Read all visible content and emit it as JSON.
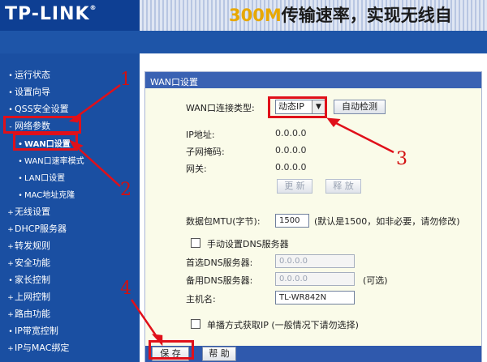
{
  "header": {
    "logo": "TP-LINK",
    "logo_mark": "®",
    "banner_prefix": "300M",
    "banner_text": "传输速率，实现无线自"
  },
  "sidebar": {
    "items": [
      {
        "label": "运行状态",
        "bullet": "•"
      },
      {
        "label": "设置向导",
        "bullet": "•"
      },
      {
        "label": "QSS安全设置",
        "bullet": "•"
      },
      {
        "label": "网络参数",
        "bullet": "-"
      },
      {
        "label": "WAN口设置",
        "bullet": "•"
      },
      {
        "label": "WAN口速率模式",
        "bullet": "•"
      },
      {
        "label": "LAN口设置",
        "bullet": "•"
      },
      {
        "label": "MAC地址克隆",
        "bullet": "•"
      },
      {
        "label": "无线设置",
        "bullet": "+"
      },
      {
        "label": "DHCP服务器",
        "bullet": "+"
      },
      {
        "label": "转发规则",
        "bullet": "+"
      },
      {
        "label": "安全功能",
        "bullet": "+"
      },
      {
        "label": "家长控制",
        "bullet": "•"
      },
      {
        "label": "上网控制",
        "bullet": "+"
      },
      {
        "label": "路由功能",
        "bullet": "+"
      },
      {
        "label": "IP带宽控制",
        "bullet": "•"
      },
      {
        "label": "IP与MAC绑定",
        "bullet": "+"
      }
    ]
  },
  "panel": {
    "title": "WAN口设置",
    "conn_type_label": "WAN口连接类型:",
    "conn_type_value": "动态IP",
    "auto_detect": "自动检测",
    "ip_label": "IP地址:",
    "ip_value": "0.0.0.0",
    "mask_label": "子网掩码:",
    "mask_value": "0.0.0.0",
    "gateway_label": "网关:",
    "gateway_value": "0.0.0.0",
    "renew": "更 新",
    "release": "释 放",
    "mtu_label": "数据包MTU(字节):",
    "mtu_value": "1500",
    "mtu_hint": "(默认是1500，如非必要，请勿修改)",
    "manual_dns": "手动设置DNS服务器",
    "dns1_label": "首选DNS服务器:",
    "dns1_value": "0.0.0.0",
    "dns2_label": "备用DNS服务器:",
    "dns2_value": "0.0.0.0",
    "dns2_hint": "(可选)",
    "hostname_label": "主机名:",
    "hostname_value": "TL-WR842N",
    "unicast": "单播方式获取IP",
    "unicast_hint": "(一般情况下请勿选择)",
    "save": "保 存",
    "help": "帮 助"
  },
  "annotations": {
    "n1": "1",
    "n2": "2",
    "n3": "3",
    "n4": "4",
    "color": "#e0101a"
  }
}
